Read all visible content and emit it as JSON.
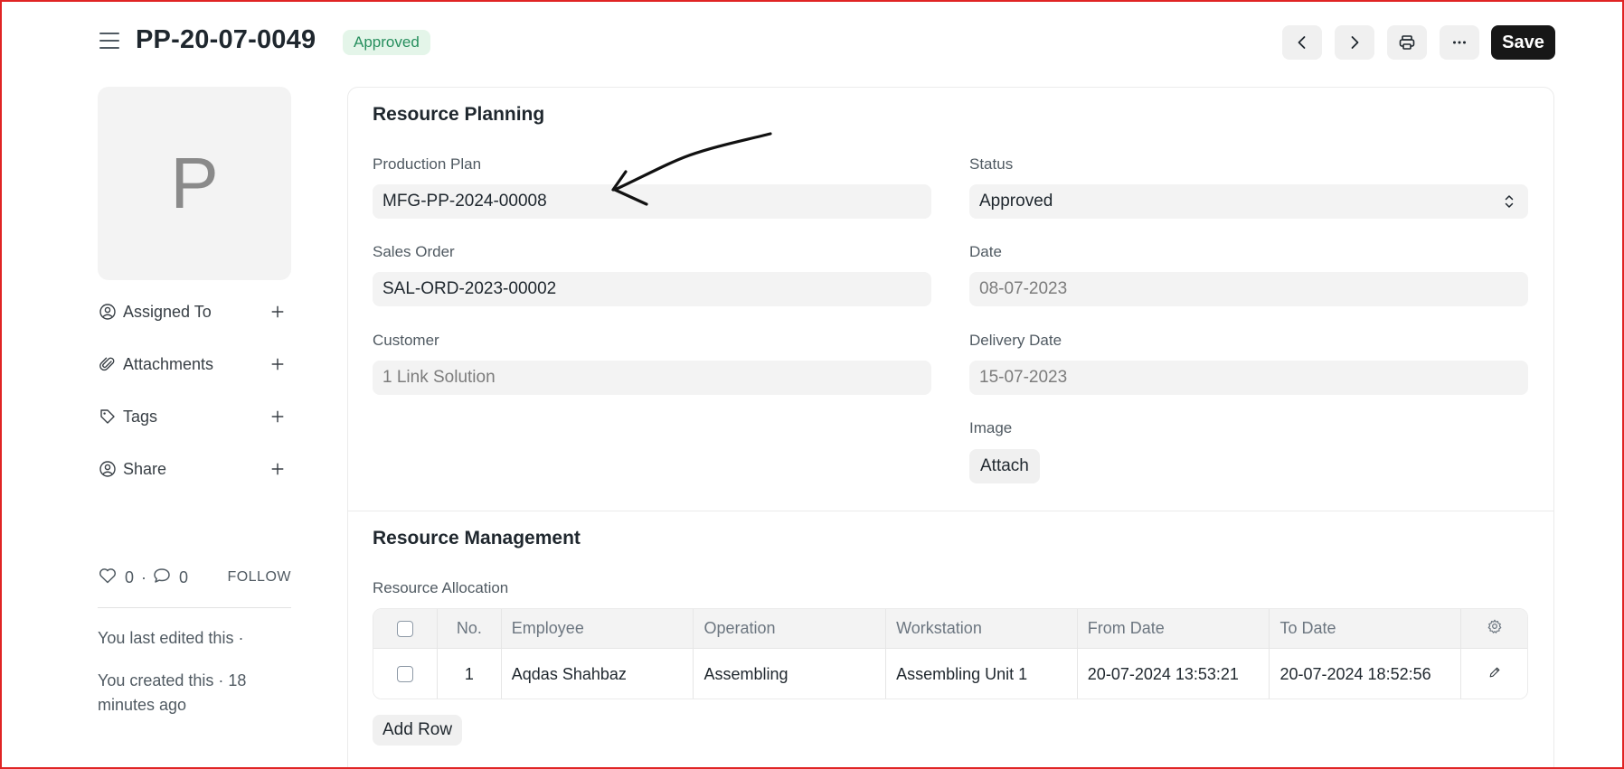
{
  "header": {
    "doc_title": "PP-20-07-0049",
    "status": "Approved",
    "save_label": "Save"
  },
  "sidebar": {
    "avatar_letter": "P",
    "items": [
      {
        "label": "Assigned To",
        "icon": "user-plus-icon"
      },
      {
        "label": "Attachments",
        "icon": "paperclip-icon"
      },
      {
        "label": "Tags",
        "icon": "tag-icon"
      },
      {
        "label": "Share",
        "icon": "user-share-icon"
      }
    ],
    "likes": "0",
    "comments": "0",
    "separator": "·",
    "follow_label": "FOLLOW",
    "last_edited": "You last edited this ·",
    "created": "You created this · 18 minutes ago"
  },
  "resource_planning": {
    "title": "Resource Planning",
    "production_plan_label": "Production Plan",
    "production_plan_value": "MFG-PP-2024-00008",
    "sales_order_label": "Sales Order",
    "sales_order_value": "SAL-ORD-2023-00002",
    "customer_label": "Customer",
    "customer_value": "1 Link Solution",
    "status_label": "Status",
    "status_value": "Approved",
    "date_label": "Date",
    "date_value": "08-07-2023",
    "delivery_date_label": "Delivery Date",
    "delivery_date_value": "15-07-2023",
    "image_label": "Image",
    "attach_label": "Attach"
  },
  "resource_management": {
    "title": "Resource Management",
    "table_label": "Resource Allocation",
    "columns": [
      "No.",
      "Employee",
      "Operation",
      "Workstation",
      "From Date",
      "To Date"
    ],
    "rows": [
      {
        "no": "1",
        "employee": "Aqdas Shahbaz",
        "operation": "Assembling",
        "workstation": "Assembling Unit 1",
        "from_date": "20-07-2024 13:53:21",
        "to_date": "20-07-2024 18:52:56"
      }
    ],
    "add_row_label": "Add Row"
  },
  "colors": {
    "accent_dark": "#171717",
    "status_green": "#278f5e",
    "status_green_bg": "#e4f5e9",
    "border_red": "#e02424"
  }
}
